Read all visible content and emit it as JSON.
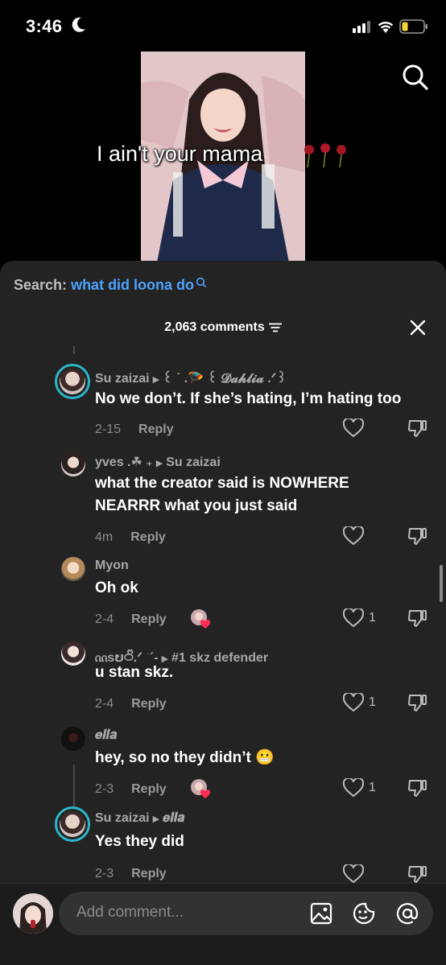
{
  "status_bar": {
    "time": "3:46",
    "icons": [
      "moon-icon",
      "signal-icon",
      "wifi-icon",
      "battery-icon"
    ]
  },
  "video": {
    "caption": "I ain't your mama"
  },
  "comments_panel": {
    "search_label": "Search:",
    "search_query": "what did loona do",
    "count": "2,063 comments",
    "comments": [
      {
        "author": "Su zaizai",
        "reply_to": "꒰ ˙ .🪂 ꒰ 𝓓𝓪𝓱𝓵𝓲𝓪 .ᐟ꒱",
        "text": "No we don’t. If she’s hating, I’m hating too",
        "date": "2-15",
        "reply_label": "Reply"
      },
      {
        "author": "yves .☘︎ ₊",
        "reply_to": "Su zaizai",
        "text": "what the creator said is NOWHERE NEARRR what you just said",
        "date": "4m",
        "reply_label": "Reply"
      },
      {
        "author": "Myon",
        "reply_to": "",
        "text": "Oh ok",
        "date": "2-4",
        "reply_label": "Reply",
        "likes": "1"
      },
      {
        "author": "ᦶsບ࿀ᩚ.ᐟ ͘ ´-",
        "reply_to": "#1 skz defender",
        "text": "u stan skz.",
        "date": "2-4",
        "reply_label": "Reply",
        "likes": "1"
      },
      {
        "author": "𝒆𝒍𝒍𝒂",
        "reply_to": "",
        "text": "hey, so no they didn’t 😬",
        "date": "2-3",
        "reply_label": "Reply",
        "likes": "1"
      },
      {
        "author": "Su zaizai",
        "reply_to": "𝒆𝒍𝒍𝒂",
        "text": "Yes they did",
        "date": "2-3",
        "reply_label": "Reply"
      }
    ]
  },
  "composer": {
    "placeholder": "Add comment..."
  },
  "colors": {
    "panel_bg": "#232323",
    "search_query": "#4ea3ff",
    "story_ring": "#2ab7c9",
    "like_heart": "#ff2d55"
  }
}
